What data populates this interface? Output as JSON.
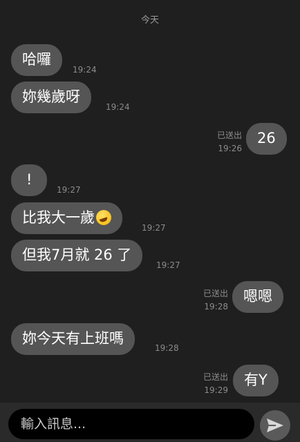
{
  "date_divider": "今天",
  "messages": [
    {
      "text": "哈囉",
      "time": "19:24"
    },
    {
      "text": "妳幾歲呀",
      "time": "19:24"
    },
    {
      "text": "26",
      "status": "已送出",
      "time": "19:26"
    },
    {
      "text": "!",
      "time": "19:27"
    },
    {
      "text": "比我大一歲",
      "emoji": "rolling-on-floor-laughing",
      "time": "19:27"
    },
    {
      "text": "但我7月就 26 了",
      "time": "19:27"
    },
    {
      "text": "嗯嗯",
      "status": "已送出",
      "time": "19:28"
    },
    {
      "text": "妳今天有上班嗎",
      "time": "19:28"
    },
    {
      "text": "有Y",
      "status": "已送出",
      "time": "19:29"
    }
  ],
  "composer": {
    "placeholder": "輸入訊息...",
    "send_icon": "paper-plane-icon"
  }
}
